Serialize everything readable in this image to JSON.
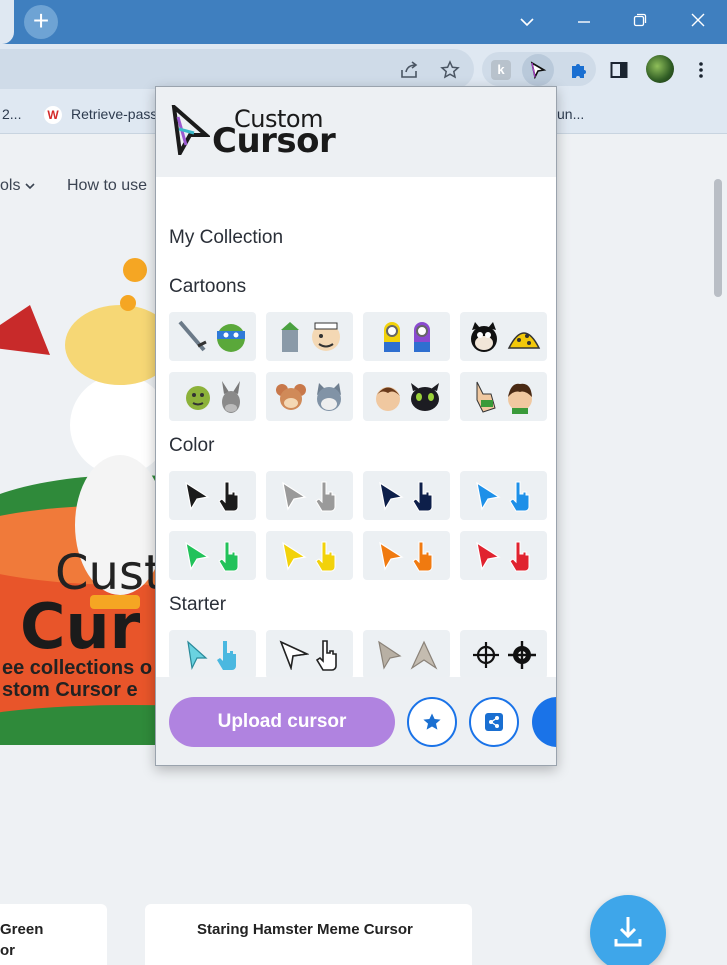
{
  "browser": {
    "bookmarks": [
      {
        "label": "2..."
      },
      {
        "label": "Retrieve-pass"
      },
      {
        "label": "un..."
      }
    ]
  },
  "page": {
    "nav": {
      "tools_label": "ols",
      "howto_label": "How to use"
    },
    "hero": {
      "logo_part1": "Cust",
      "logo_part2": "Cur",
      "tagline_1": "ee collections o",
      "tagline_2": "stom Cursor e"
    },
    "cards": [
      {
        "line1": "Green",
        "line2": "or"
      },
      {
        "title": "Staring Hamster Meme Cursor"
      }
    ]
  },
  "popup": {
    "logo": {
      "line1": "Custom",
      "line2": "Cursor"
    },
    "sections": {
      "my_collection": "My Collection",
      "cartoons": "Cartoons",
      "color": "Color",
      "starter": "Starter"
    },
    "cartoons": [
      {
        "name": "Leonardo TMNT"
      },
      {
        "name": "Popeye"
      },
      {
        "name": "Minions"
      },
      {
        "name": "Felix the Cat"
      },
      {
        "name": "Shrek"
      },
      {
        "name": "Tom and Jerry"
      },
      {
        "name": "How to Train Your Dragon"
      },
      {
        "name": "Ben 10"
      }
    ],
    "colors": [
      "#1b1b1b",
      "#9a9a9a",
      "#0d1f4a",
      "#1e90e8",
      "#22c25a",
      "#f2d20a",
      "#f07a10",
      "#e0232f"
    ],
    "footer": {
      "upload_label": "Upload cursor"
    }
  }
}
